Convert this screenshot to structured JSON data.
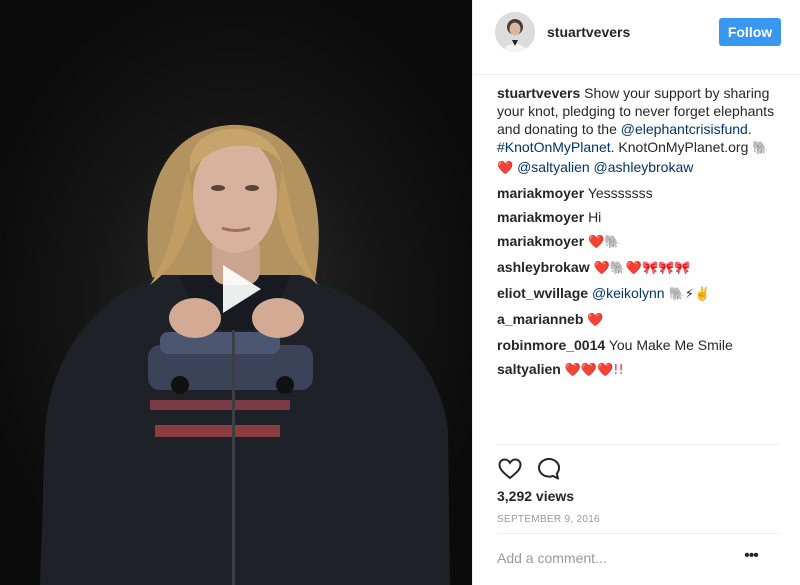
{
  "post": {
    "author": "stuartvevers",
    "follow_label": "Follow",
    "caption": {
      "user": "stuartvevers",
      "text_1": " Show your support by sharing your knot, pledging to never forget elephants and donating to the ",
      "mention_1": "@elephantcrisisfund",
      "text_2": ". ",
      "hashtag": "#KnotOnMyPlanet",
      "text_3": ". KnotOnMyPlanet.org ",
      "emoji_1": "🐘",
      "emoji_2": "❤️",
      "mention_2": "@saltyalien",
      "mention_3": "@ashleybrokaw"
    },
    "comments": [
      {
        "user": "mariakmoyer",
        "text": "Yesssssss"
      },
      {
        "user": "mariakmoyer",
        "text": "Hi"
      },
      {
        "user": "mariakmoyer",
        "text": "❤️🐘"
      },
      {
        "user": "ashleybrokaw",
        "text": "❤️🐘❤️🎀🎀🎀"
      },
      {
        "user": "eliot_wvillage",
        "mention": "@keikolynn",
        "text": " 🐘⚡✌️"
      },
      {
        "user": "a_marianneb",
        "text": "❤️"
      },
      {
        "user": "robinmore_0014",
        "text": "You Make Me Smile"
      },
      {
        "user": "saltyalien",
        "text": "❤️❤️❤️!!"
      }
    ],
    "views": "3,292 views",
    "date": "SEPTEMBER 9, 2016",
    "add_comment_placeholder": "Add a comment...",
    "more_label": "•••",
    "icons": {
      "like": "heart-outline-icon",
      "comment": "speech-bubble-icon",
      "play": "play-icon",
      "more": "ellipsis-icon"
    },
    "colors": {
      "follow": "#3897f0",
      "link": "#003569",
      "muted": "#999999"
    }
  }
}
